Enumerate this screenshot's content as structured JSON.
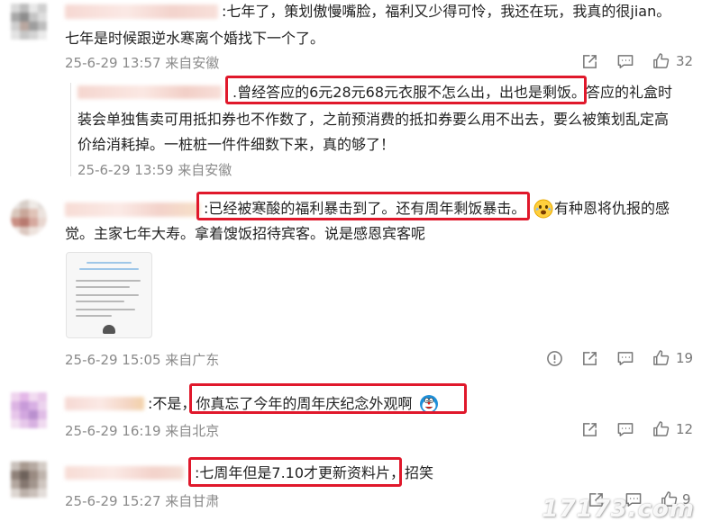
{
  "comments": [
    {
      "line1": ":七年了，策划傲慢嘴脸，福利又少得可怜，我还在玩，我真的很jian。",
      "line2": "七年是时候跟逆水寒离个婚找下一个了。",
      "meta": "25-6-29 13:57 来自安徽",
      "like_count": "32",
      "reply": {
        "line1_pre": ".",
        "line1_boxed": "曾经答应的6元28元68元衣服不怎么出，出也是剩饭。",
        "line1_post": "答应的礼盒时",
        "line2": "装会单独售卖可用抵扣券也不作数了，之前预消费的抵扣券要么用不出去，要么被策划乱定高",
        "line3": "价给消耗掉。一桩桩一件件细数下来，真的够了！",
        "meta": "25-6-29 13:59 来自安徽"
      }
    },
    {
      "line1_pre": ":",
      "line1_boxed": "已经被寒酸的福利暴击到了。还有周年剩饭暴击。",
      "line1_post": "有种恩将仇报的感",
      "line2": "觉。主家七年大寿。拿着馊饭招待宾客。说是感恩宾客呢",
      "meta": "25-6-29 15:05 来自广东",
      "like_count": "19"
    },
    {
      "line1_pre": ":不是，",
      "line1_boxed": "你真忘了今年的周年庆纪念外观啊",
      "meta": "25-6-29 16:19 来自北京",
      "like_count": "12"
    },
    {
      "line1_pre": ":",
      "line1_boxed": "七周年但是7.10才更新资料片",
      "line1_post": "，招笑",
      "meta": "25-6-29 15:27 来自甘肃",
      "like_count": "9"
    }
  ],
  "watermark": "17173.com",
  "colors": {
    "highlight_box": "#e0182b",
    "meta_text": "#8a8a8a"
  }
}
